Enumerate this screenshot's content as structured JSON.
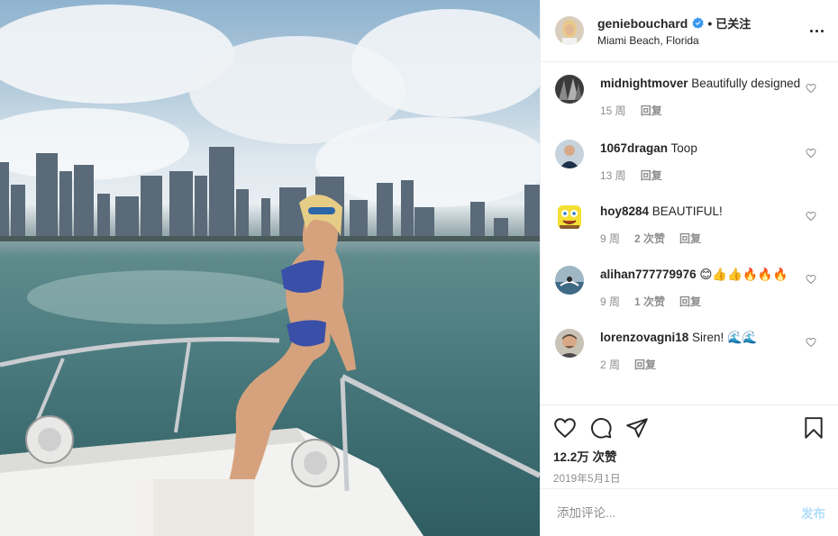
{
  "post": {
    "username": "geniebouchard",
    "follow_state": "已关注",
    "location": "Miami Beach, Florida",
    "likes": "12.2万 次赞",
    "date": "2019年5月1日"
  },
  "comments": [
    {
      "user": "midnightmover",
      "text": " Beautifully designed",
      "time": "15 周",
      "likes": "",
      "reply": "回复"
    },
    {
      "user": "1067dragan",
      "text": " Toop",
      "time": "13 周",
      "likes": "",
      "reply": "回复"
    },
    {
      "user": "hoy8284",
      "text": " BEAUTIFUL!",
      "time": "9 周",
      "likes": "2 次赞",
      "reply": "回复"
    },
    {
      "user": "alihan777779976",
      "text": " 😊👍👍🔥🔥🔥",
      "time": "9 周",
      "likes": "1 次赞",
      "reply": "回复"
    },
    {
      "user": "lorenzovagni18",
      "text": " Siren! 🌊🌊",
      "time": "2 周",
      "likes": "",
      "reply": "回复"
    }
  ],
  "add_comment": {
    "placeholder": "添加评论...",
    "post_label": "发布"
  },
  "colors": {
    "verified": "#3897f0",
    "muted": "#8e8e8e",
    "post_disabled": "#b2dffc"
  },
  "icons": [
    "more-icon",
    "heart-icon",
    "comment-icon",
    "share-icon",
    "bookmark-icon",
    "verified-icon"
  ]
}
